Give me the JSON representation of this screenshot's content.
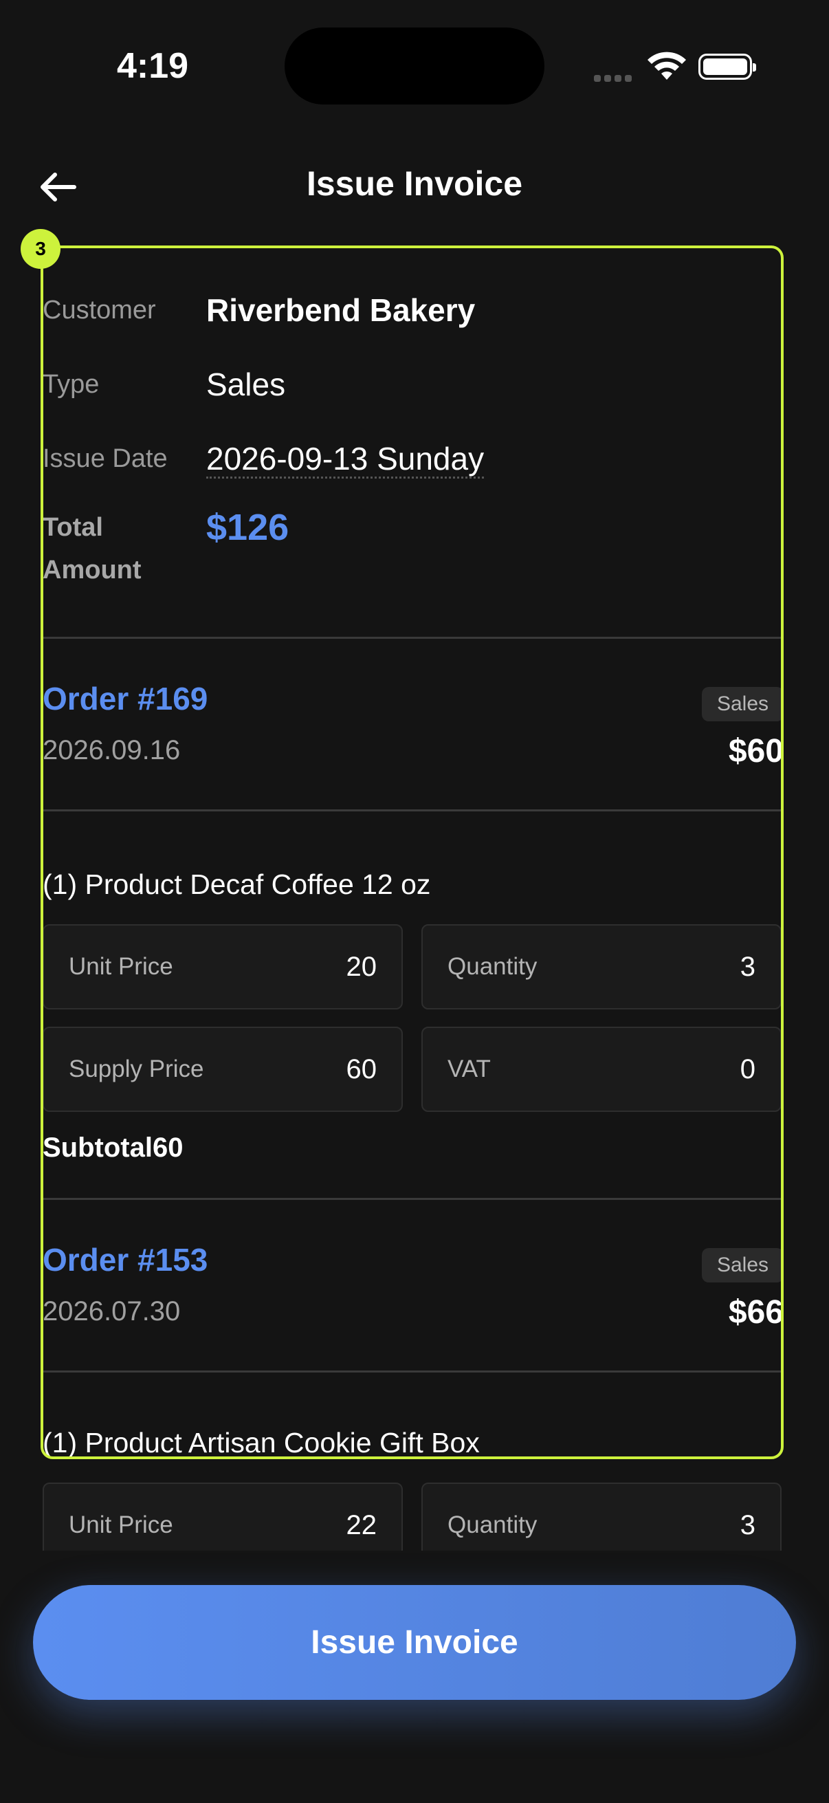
{
  "status": {
    "time": "4:19"
  },
  "header": {
    "title": "Issue Invoice"
  },
  "invoice": {
    "customer_label": "Customer",
    "customer_value": "Riverbend Bakery",
    "type_label": "Type",
    "type_value": "Sales",
    "issue_date_label": "Issue Date",
    "issue_date_value": "2026-09-13 Sunday",
    "total_label": "Total Amount",
    "total_value": "$126"
  },
  "orders": [
    {
      "title": "Order #169",
      "badge": "Sales",
      "date": "2026.09.16",
      "amount": "$60",
      "product": "(1) Product Decaf Coffee 12 oz",
      "unit_price_label": "Unit Price",
      "unit_price": "20",
      "quantity_label": "Quantity",
      "quantity": "3",
      "supply_price_label": "Supply Price",
      "supply_price": "60",
      "vat_label": "VAT",
      "vat": "0",
      "subtotal": "Subtotal60"
    },
    {
      "title": "Order #153",
      "badge": "Sales",
      "date": "2026.07.30",
      "amount": "$66",
      "product": "(1) Product Artisan Cookie Gift Box",
      "unit_price_label": "Unit Price",
      "unit_price": "22",
      "quantity_label": "Quantity",
      "quantity": "3"
    }
  ],
  "marker": {
    "label": "3"
  },
  "actions": {
    "issue_button": "Issue Invoice"
  },
  "colors": {
    "accent": "#5b8ef0",
    "highlight": "#cdf23c",
    "background": "#141414"
  }
}
